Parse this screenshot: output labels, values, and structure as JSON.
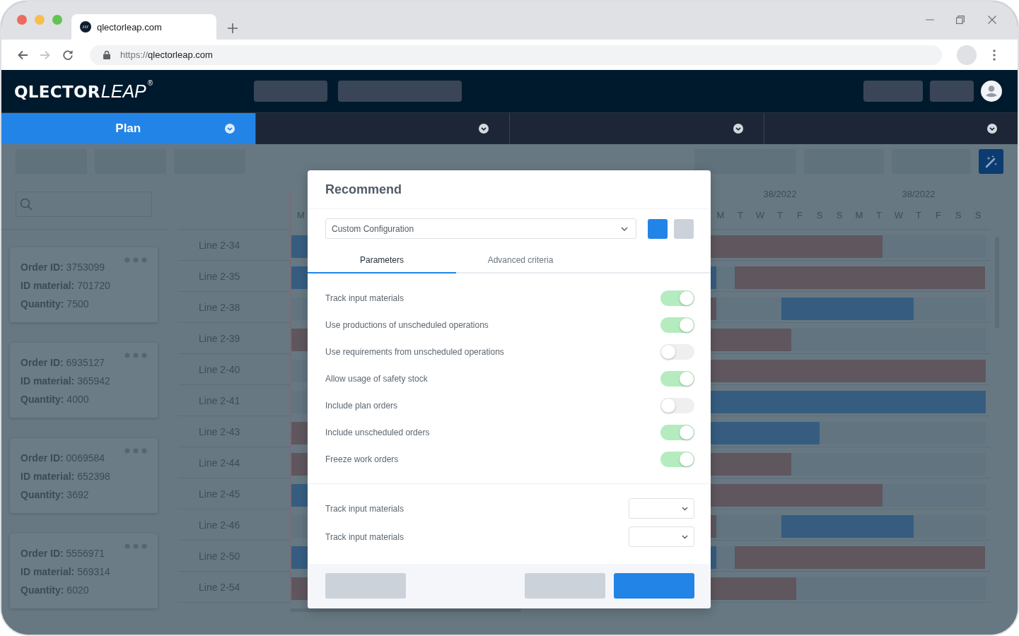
{
  "browser": {
    "tab": {
      "title": "qlectorleap.com"
    },
    "controls": [
      {
        "kind": "back",
        "disabled": false
      },
      {
        "kind": "forward",
        "disabled": true
      },
      {
        "kind": "reload",
        "disabled": false
      }
    ],
    "address": {
      "scheme": "https://",
      "host": "qlectorleap.com"
    }
  },
  "app": {
    "logo": {
      "brand": "QLECTOR",
      "product": "LEAP",
      "mark": "®"
    }
  },
  "nav_tabs": [
    {
      "label": "Plan",
      "selected": true
    },
    {
      "selected": false
    },
    {
      "selected": false
    },
    {
      "selected": false
    }
  ],
  "order_cards": [
    {
      "lines": [
        "**Order ID:** 3753099",
        "**ID material:** 701720",
        "**Quantity:** 7500"
      ]
    },
    {
      "lines": [
        "**Order ID:** 6935127",
        "**ID material:** 365942",
        "**Quantity:** 4000"
      ]
    },
    {
      "lines": [
        "**Order ID:** 0069584",
        "**ID material:** 652398",
        "**Quantity:** 3692"
      ]
    },
    {
      "lines": [
        "**Order ID:** 5556971",
        "**ID material:** 569314",
        "**Quantity:** 6020"
      ]
    }
  ],
  "lines": [
    "Line 2-34",
    "Line 2-35",
    "Line 2-38",
    "Line 2-39",
    "Line 2-40",
    "Line 2-41",
    "Line 2-43",
    "Line 2-44",
    "Line 2-45",
    "Line 2-46",
    "Line 2-50",
    "Line 2-54"
  ],
  "timeline": {
    "left_days": [
      "M"
    ],
    "weeks": [
      {
        "label": "38/2022",
        "days": [
          "M",
          "T",
          "W",
          "T",
          "F",
          "S",
          "S"
        ]
      },
      {
        "label": "38/2022",
        "days": [
          "M",
          "T",
          "W",
          "T",
          "F",
          "S",
          "S"
        ]
      }
    ]
  },
  "dialog": {
    "title": "Recommend",
    "configuration": {
      "value": "Custom Configuration"
    },
    "tabs": [
      {
        "label": "Parameters",
        "selected": true
      },
      {
        "label": "Advanced criteria",
        "selected": false
      }
    ],
    "toggles": [
      {
        "label": "Track input materials",
        "on": true
      },
      {
        "label": "Use productions of unscheduled operations",
        "on": true
      },
      {
        "label": "Use requirements from unscheduled operations",
        "on": false
      },
      {
        "label": "Allow usage of safety stock",
        "on": true
      },
      {
        "label": "Include plan orders",
        "on": false
      },
      {
        "label": "Include unscheduled orders",
        "on": true
      },
      {
        "label": "Freeze work orders",
        "on": true
      }
    ],
    "selects": [
      {
        "label": "Track input materials"
      },
      {
        "label": "Track input materials"
      }
    ]
  }
}
